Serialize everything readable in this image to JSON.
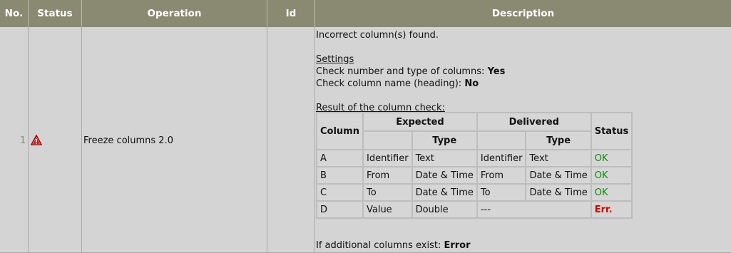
{
  "header": {
    "no": "No.",
    "status": "Status",
    "operation": "Operation",
    "id": "Id",
    "description": "Description"
  },
  "row": {
    "number": "1",
    "status_icon": "warning-triangle-icon",
    "operation": "Freeze columns 2.0",
    "id": "",
    "description": {
      "summary": "Incorrect column(s) found.",
      "settings_title": "Settings",
      "setting1_label": "Check number and type of columns: ",
      "setting1_value": "Yes",
      "setting2_label": "Check column name (heading): ",
      "setting2_value": "No",
      "result_title": "Result of the column check:",
      "table": {
        "col_column": "Column",
        "col_expected": "Expected",
        "col_delivered": "Delivered",
        "col_status": "Status",
        "sub_type_expected": "Type",
        "sub_type_delivered": "Type",
        "rows": [
          {
            "column": "A",
            "exp_name": "Identifier",
            "exp_type": "Text",
            "del_name": "Identifier",
            "del_type": "Text",
            "status": "OK"
          },
          {
            "column": "B",
            "exp_name": "From",
            "exp_type": "Date & Time",
            "del_name": "From",
            "del_type": "Date & Time",
            "status": "OK"
          },
          {
            "column": "C",
            "exp_name": "To",
            "exp_type": "Date & Time",
            "del_name": "To",
            "del_type": "Date & Time",
            "status": "OK"
          },
          {
            "column": "D",
            "exp_name": "Value",
            "exp_type": "Double",
            "del_merged": "---",
            "status": "Err."
          }
        ]
      },
      "footer_label": "If additional columns exist: ",
      "footer_value": "Error"
    }
  },
  "colors": {
    "header_bg": "#8a8a73",
    "body_bg": "#d4d4d4",
    "ok": "#0a8a0a",
    "err": "#cc0000"
  }
}
